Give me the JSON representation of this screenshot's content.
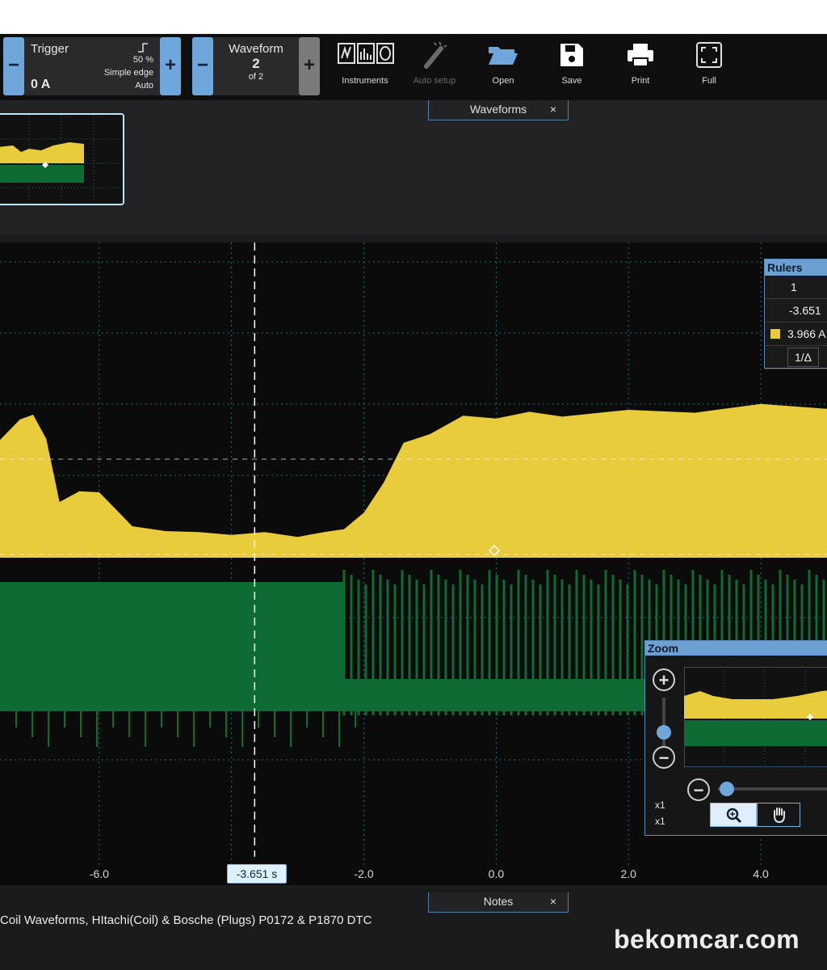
{
  "trigger": {
    "title": "Trigger",
    "value": "0 A",
    "level": "50 %",
    "mode": "Simple edge",
    "auto": "Auto",
    "minus": "−",
    "plus": "+"
  },
  "waveform": {
    "title": "Waveform",
    "number": "2",
    "of": "of 2",
    "minus": "−",
    "plus": "+"
  },
  "toolbar": {
    "instruments_label": "Instruments",
    "auto_setup_label": "Auto setup",
    "open_label": "Open",
    "save_label": "Save",
    "print_label": "Print",
    "full_label": "Full"
  },
  "tabs": {
    "waveforms": "Waveforms",
    "notes": "Notes",
    "close": "×"
  },
  "rulers": {
    "title": "Rulers",
    "index": "1",
    "time": "-3.651",
    "value": "3.966 A",
    "inv": "1/Δ"
  },
  "zoom": {
    "title": "Zoom",
    "x1a": "x1",
    "x1b": "x1",
    "plus": "+",
    "minus": "−"
  },
  "cursor_time": "-3.651 s",
  "notes_text": "Coil Waveforms, HItachi(Coil) & Bosche (Plugs) P0172 & P1870 DTC",
  "watermark": "bekomcar.com",
  "colors": {
    "ch_a": "#e8cc3c",
    "ch_b": "#0e6b34",
    "accent": "#6fa6dc"
  },
  "chart_data": {
    "type": "area",
    "x_ticks": [
      "-6.0",
      "-2.0",
      "0.0",
      "2.0",
      "4.0"
    ],
    "xlim": [
      -7.5,
      5.0
    ],
    "grid": true,
    "series": [
      {
        "color": "#e8cc3c",
        "x": [
          -7.5,
          -7.2,
          -7.0,
          -6.8,
          -6.6,
          -6.3,
          -6.0,
          -5.5,
          -5.0,
          -4.5,
          -4.0,
          -3.5,
          -3.0,
          -2.6,
          -2.3,
          -2.0,
          -1.7,
          -1.4,
          -1.0,
          -0.5,
          0.0,
          0.5,
          1.0,
          2.0,
          3.0,
          4.0,
          5.0
        ],
        "y": [
          0.62,
          0.7,
          0.75,
          0.6,
          0.3,
          0.33,
          0.35,
          0.15,
          0.15,
          0.12,
          0.13,
          0.12,
          0.12,
          0.12,
          0.16,
          0.22,
          0.4,
          0.58,
          0.65,
          0.72,
          0.73,
          0.74,
          0.74,
          0.75,
          0.76,
          0.78,
          0.78
        ]
      },
      {
        "color": "#0e6b34"
      }
    ],
    "cursor_x": -3.651
  }
}
